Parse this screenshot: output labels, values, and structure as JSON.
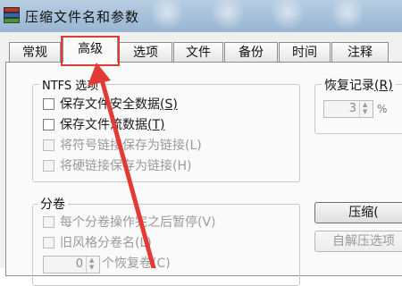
{
  "window": {
    "title": "压缩文件名和参数",
    "app_icon": "winrar-books-icon"
  },
  "tabs": [
    {
      "label": "常规"
    },
    {
      "label": "高级"
    },
    {
      "label": "选项"
    },
    {
      "label": "文件"
    },
    {
      "label": "备份"
    },
    {
      "label": "时间"
    },
    {
      "label": "注释"
    }
  ],
  "active_tab": "高级",
  "ntfs": {
    "legend": "NTFS 选项",
    "options": [
      {
        "label": "保存文件安全数据",
        "key": "(S)",
        "checked": false,
        "disabled": false
      },
      {
        "label": "保存文件流数据",
        "key": "(T)",
        "checked": false,
        "disabled": false
      },
      {
        "label": "将符号链接保存为链接",
        "key": "(L)",
        "checked": false,
        "disabled": true
      },
      {
        "label": "将硬链接保存为链接",
        "key": "(H)",
        "checked": false,
        "disabled": true
      }
    ]
  },
  "recovery": {
    "legend": "恢复记录",
    "key": "(R)",
    "value": "3",
    "unit": "%"
  },
  "volumes": {
    "legend": "分卷",
    "options": [
      {
        "label": "每个分卷操作完之后暂停",
        "key": "(V)",
        "checked": false,
        "disabled": true
      },
      {
        "label": "旧风格分卷名",
        "key": "(L)",
        "checked": false,
        "disabled": true
      }
    ],
    "spinner": {
      "value": "0",
      "label": "个恢复卷",
      "key": "(C)"
    }
  },
  "buttons": {
    "compress": {
      "label": "压缩",
      "key": "("
    },
    "sfx": {
      "label": "自解压选项"
    }
  },
  "annotation": {
    "color": "#e43a35"
  }
}
